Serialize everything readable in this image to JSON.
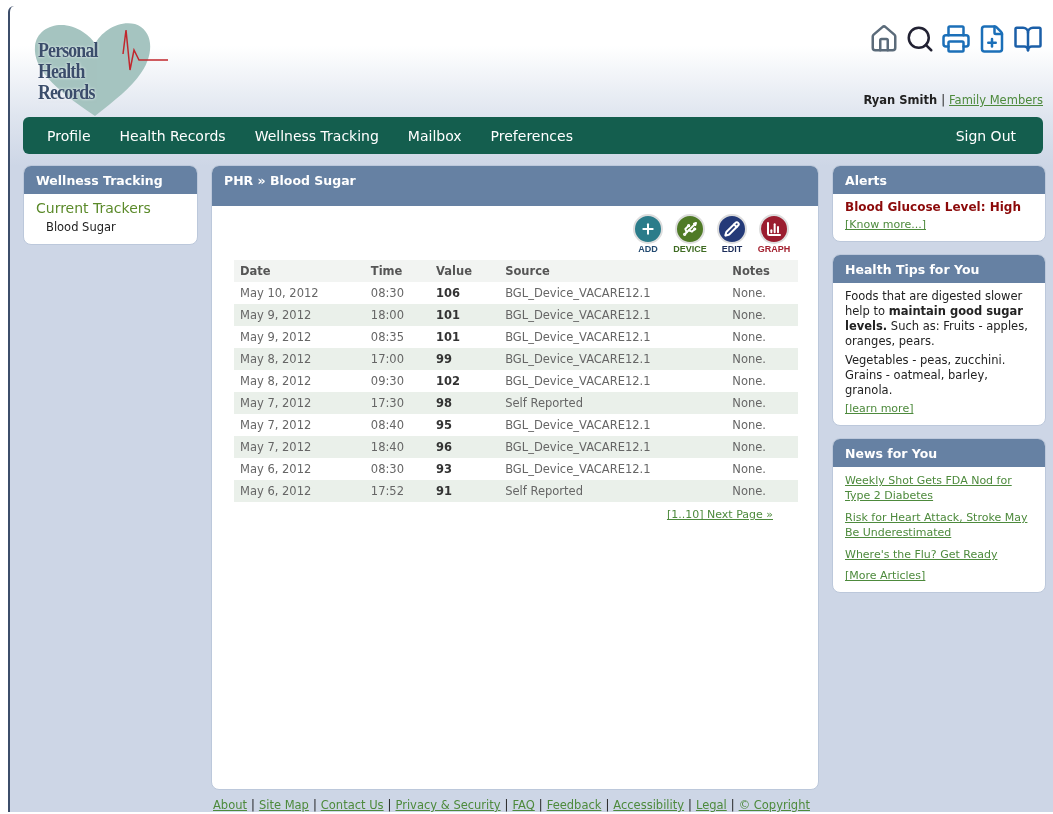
{
  "logo": {
    "lines": [
      "Personal",
      "Health",
      "Records"
    ]
  },
  "user": {
    "name": "Ryan Smith",
    "separator": "|",
    "link": "Family Members"
  },
  "nav": {
    "items": [
      "Profile",
      "Health Records",
      "Wellness Tracking",
      "Mailbox",
      "Preferences"
    ],
    "sign_out": "Sign Out"
  },
  "sidebar": {
    "title": "Wellness Tracking",
    "section": "Current Trackers",
    "items": [
      "Blood Sugar"
    ]
  },
  "main": {
    "breadcrumb": "PHR » Blood Sugar",
    "actions": [
      {
        "kind": "add",
        "label": "ADD"
      },
      {
        "kind": "device",
        "label": "DEVICE"
      },
      {
        "kind": "edit",
        "label": "EDIT"
      },
      {
        "kind": "graph",
        "label": "GRAPH"
      }
    ],
    "table": {
      "columns": [
        "Date",
        "Time",
        "Value",
        "Source",
        "Notes"
      ],
      "rows": [
        [
          "May 10, 2012",
          "08:30",
          "106",
          "BGL_Device_VACARE12.1",
          "None."
        ],
        [
          "May 9, 2012",
          "18:00",
          "101",
          "BGL_Device_VACARE12.1",
          "None."
        ],
        [
          "May 9, 2012",
          "08:35",
          "101",
          "BGL_Device_VACARE12.1",
          "None."
        ],
        [
          "May 8, 2012",
          "17:00",
          "99",
          "BGL_Device_VACARE12.1",
          "None."
        ],
        [
          "May 8, 2012",
          "09:30",
          "102",
          "BGL_Device_VACARE12.1",
          "None."
        ],
        [
          "May 7, 2012",
          "17:30",
          "98",
          "Self Reported",
          "None."
        ],
        [
          "May 7, 2012",
          "08:40",
          "95",
          "BGL_Device_VACARE12.1",
          "None."
        ],
        [
          "May 7, 2012",
          "18:40",
          "96",
          "BGL_Device_VACARE12.1",
          "None."
        ],
        [
          "May 6, 2012",
          "08:30",
          "93",
          "BGL_Device_VACARE12.1",
          "None."
        ],
        [
          "May 6, 2012",
          "17:52",
          "91",
          "Self Reported",
          "None."
        ]
      ]
    },
    "pager": "[1..10] Next Page »"
  },
  "alerts": {
    "title": "Alerts",
    "message": "Blood Glucose Level: High",
    "link": "[Know more...]"
  },
  "tips": {
    "title": "Health Tips for You",
    "paragraphs": [
      "Foods that are digested slower help to **maintain good sugar levels.** Such as: Fruits - apples, oranges, pears.",
      "Vegetables - peas, zucchini. Grains - oatmeal, barley, granola."
    ],
    "link": "[learn more]"
  },
  "news": {
    "title": "News for You",
    "items": [
      "Weekly Shot Gets FDA Nod for Type 2 Diabetes",
      "Risk for Heart Attack, Stroke May Be Underestimated",
      "Where's the Flu? Get Ready"
    ],
    "more": "[More Articles]"
  },
  "footer": {
    "links": [
      "About",
      "Site Map",
      "Contact Us",
      "Privacy & Security",
      "FAQ",
      "Feedback",
      "Accessibility",
      "Legal",
      "© Copyright"
    ],
    "separator": "|"
  }
}
